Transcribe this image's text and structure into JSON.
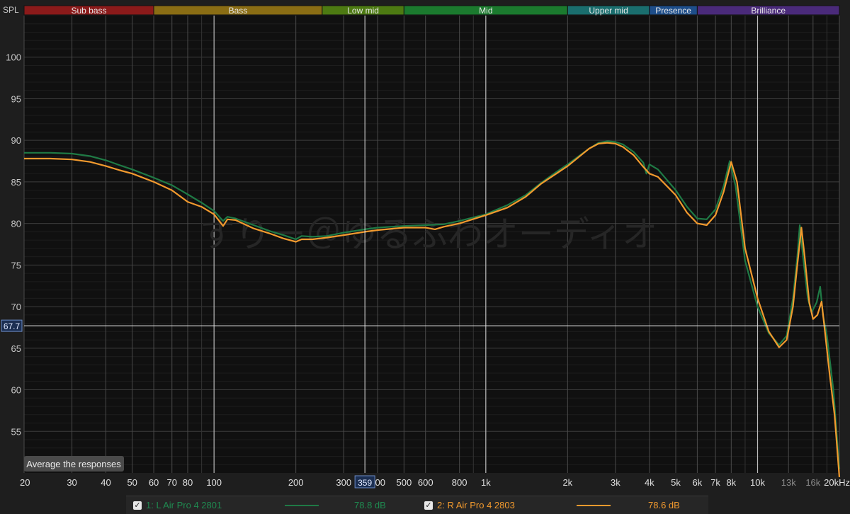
{
  "chart_data": {
    "type": "line",
    "ylabel": "SPL",
    "xunit": "kHz",
    "xscale": "log",
    "xlim": [
      20,
      20000
    ],
    "ylim": [
      50,
      105
    ],
    "grid": true,
    "bands": [
      {
        "label": "Sub bass",
        "from": 20,
        "to": 60,
        "color": "#8b1a1a"
      },
      {
        "label": "Bass",
        "from": 60,
        "to": 250,
        "color": "#8a6d14"
      },
      {
        "label": "Low mid",
        "from": 250,
        "to": 500,
        "color": "#4d7a12"
      },
      {
        "label": "Mid",
        "from": 500,
        "to": 2000,
        "color": "#1b7a2e"
      },
      {
        "label": "Upper mid",
        "from": 2000,
        "to": 4000,
        "color": "#1a6e6e"
      },
      {
        "label": "Presence",
        "from": 4000,
        "to": 6000,
        "color": "#1e4e8a"
      },
      {
        "label": "Brilliance",
        "from": 6000,
        "to": 20000,
        "color": "#4a2a7a"
      }
    ],
    "yticks": [
      55,
      60,
      65,
      70,
      75,
      80,
      85,
      90,
      95,
      100
    ],
    "xticks": [
      {
        "v": 20,
        "label": "20"
      },
      {
        "v": 30,
        "label": "30"
      },
      {
        "v": 40,
        "label": "40"
      },
      {
        "v": 50,
        "label": "50"
      },
      {
        "v": 60,
        "label": "60"
      },
      {
        "v": 70,
        "label": "70"
      },
      {
        "v": 80,
        "label": "80"
      },
      {
        "v": 100,
        "label": "100"
      },
      {
        "v": 200,
        "label": "200"
      },
      {
        "v": 300,
        "label": "300"
      },
      {
        "v": 400,
        "label": "400"
      },
      {
        "v": 500,
        "label": "500"
      },
      {
        "v": 600,
        "label": "600"
      },
      {
        "v": 800,
        "label": "800"
      },
      {
        "v": 1000,
        "label": "1k"
      },
      {
        "v": 2000,
        "label": "2k"
      },
      {
        "v": 3000,
        "label": "3k"
      },
      {
        "v": 4000,
        "label": "4k"
      },
      {
        "v": 5000,
        "label": "5k"
      },
      {
        "v": 6000,
        "label": "6k"
      },
      {
        "v": 7000,
        "label": "7k"
      },
      {
        "v": 8000,
        "label": "8k"
      },
      {
        "v": 10000,
        "label": "10k"
      },
      {
        "v": 13000,
        "label": "13k"
      },
      {
        "v": 16000,
        "label": "16k"
      },
      {
        "v": 20000,
        "label": "20kHz"
      }
    ],
    "minor_x": [
      90,
      900,
      9000,
      18000
    ],
    "cursor": {
      "x": 359,
      "x_label": "359",
      "y": 67.7,
      "y_label": "67.7"
    },
    "watermark": "すりー＠ゆるふわオーディオ",
    "series": [
      {
        "name": "1: L Air Pro 4 2801",
        "color": "#1f7a45",
        "avg_label": "78.8 dB",
        "points": [
          [
            20,
            88.5
          ],
          [
            25,
            88.5
          ],
          [
            30,
            88.4
          ],
          [
            35,
            88.1
          ],
          [
            40,
            87.6
          ],
          [
            45,
            87.0
          ],
          [
            50,
            86.5
          ],
          [
            60,
            85.5
          ],
          [
            70,
            84.6
          ],
          [
            80,
            83.5
          ],
          [
            90,
            82.5
          ],
          [
            100,
            81.5
          ],
          [
            108,
            80.3
          ],
          [
            112,
            80.8
          ],
          [
            120,
            80.6
          ],
          [
            140,
            79.8
          ],
          [
            160,
            79.1
          ],
          [
            180,
            78.6
          ],
          [
            200,
            78.1
          ],
          [
            210,
            78.5
          ],
          [
            230,
            78.4
          ],
          [
            260,
            78.5
          ],
          [
            300,
            78.9
          ],
          [
            359,
            79.3
          ],
          [
            400,
            79.5
          ],
          [
            500,
            79.7
          ],
          [
            600,
            79.8
          ],
          [
            700,
            79.9
          ],
          [
            800,
            80.3
          ],
          [
            1000,
            81.1
          ],
          [
            1200,
            82.2
          ],
          [
            1400,
            83.4
          ],
          [
            1600,
            84.9
          ],
          [
            1800,
            86.1
          ],
          [
            2000,
            87.1
          ],
          [
            2200,
            88.1
          ],
          [
            2400,
            89.0
          ],
          [
            2600,
            89.7
          ],
          [
            2800,
            89.9
          ],
          [
            3000,
            89.8
          ],
          [
            3200,
            89.5
          ],
          [
            3500,
            88.6
          ],
          [
            3800,
            87.3
          ],
          [
            3900,
            86.0
          ],
          [
            4000,
            87.1
          ],
          [
            4300,
            86.5
          ],
          [
            5000,
            84.0
          ],
          [
            5500,
            82.0
          ],
          [
            6000,
            80.6
          ],
          [
            6500,
            80.5
          ],
          [
            7000,
            81.7
          ],
          [
            7500,
            84.5
          ],
          [
            7900,
            87.5
          ],
          [
            8300,
            84.5
          ],
          [
            9000,
            75.5
          ],
          [
            10000,
            70.0
          ],
          [
            11000,
            66.8
          ],
          [
            12000,
            65.4
          ],
          [
            12800,
            66.5
          ],
          [
            13500,
            71.0
          ],
          [
            14000,
            76.0
          ],
          [
            14300,
            79.8
          ],
          [
            14700,
            76.0
          ],
          [
            15300,
            71.0
          ],
          [
            15800,
            69.3
          ],
          [
            16500,
            70.5
          ],
          [
            17000,
            72.4
          ],
          [
            17400,
            69.0
          ],
          [
            18000,
            66.5
          ],
          [
            19000,
            60.0
          ],
          [
            20000,
            50.5
          ]
        ]
      },
      {
        "name": "2: R Air Pro 4 2803",
        "color": "#f29a2e",
        "avg_label": "78.6 dB",
        "points": [
          [
            20,
            87.8
          ],
          [
            25,
            87.8
          ],
          [
            30,
            87.7
          ],
          [
            35,
            87.4
          ],
          [
            40,
            86.9
          ],
          [
            45,
            86.4
          ],
          [
            50,
            86.0
          ],
          [
            60,
            85.0
          ],
          [
            70,
            84.0
          ],
          [
            80,
            82.6
          ],
          [
            90,
            82.0
          ],
          [
            100,
            81.1
          ],
          [
            108,
            79.7
          ],
          [
            112,
            80.5
          ],
          [
            120,
            80.4
          ],
          [
            140,
            79.4
          ],
          [
            160,
            78.8
          ],
          [
            180,
            78.2
          ],
          [
            200,
            77.8
          ],
          [
            210,
            78.1
          ],
          [
            230,
            78.1
          ],
          [
            260,
            78.3
          ],
          [
            300,
            78.6
          ],
          [
            359,
            79.0
          ],
          [
            400,
            79.2
          ],
          [
            500,
            79.5
          ],
          [
            600,
            79.5
          ],
          [
            650,
            79.3
          ],
          [
            700,
            79.6
          ],
          [
            800,
            80.0
          ],
          [
            1000,
            81.0
          ],
          [
            1200,
            81.9
          ],
          [
            1400,
            83.2
          ],
          [
            1600,
            84.8
          ],
          [
            1800,
            85.9
          ],
          [
            2000,
            86.9
          ],
          [
            2200,
            88.0
          ],
          [
            2400,
            89.0
          ],
          [
            2600,
            89.6
          ],
          [
            2800,
            89.7
          ],
          [
            3000,
            89.6
          ],
          [
            3200,
            89.2
          ],
          [
            3500,
            88.2
          ],
          [
            3800,
            86.8
          ],
          [
            4000,
            86.0
          ],
          [
            4300,
            85.6
          ],
          [
            5000,
            83.4
          ],
          [
            5500,
            81.3
          ],
          [
            6000,
            80.0
          ],
          [
            6500,
            79.8
          ],
          [
            7000,
            81.0
          ],
          [
            7500,
            83.8
          ],
          [
            8000,
            87.4
          ],
          [
            8400,
            85.0
          ],
          [
            9000,
            77.0
          ],
          [
            10000,
            71.0
          ],
          [
            11000,
            67.0
          ],
          [
            12000,
            65.1
          ],
          [
            12800,
            66.0
          ],
          [
            13500,
            70.0
          ],
          [
            14000,
            75.0
          ],
          [
            14500,
            79.5
          ],
          [
            14900,
            76.0
          ],
          [
            15500,
            70.5
          ],
          [
            16000,
            68.5
          ],
          [
            16600,
            69.0
          ],
          [
            17200,
            70.6
          ],
          [
            17700,
            67.0
          ],
          [
            18400,
            62.0
          ],
          [
            19200,
            57.0
          ],
          [
            20000,
            49.5
          ]
        ]
      }
    ]
  },
  "button_label": "Average the responses",
  "legend": [
    {
      "check": "✓",
      "name": "1: L Air Pro 4 2801",
      "value": "78.8 dB",
      "color": "#1f7a45",
      "text_color": "#1f8a50"
    },
    {
      "check": "✓",
      "name": "2: R Air Pro 4 2803",
      "value": "78.6 dB",
      "color": "#f29a2e",
      "text_color": "#f29a2e"
    }
  ]
}
